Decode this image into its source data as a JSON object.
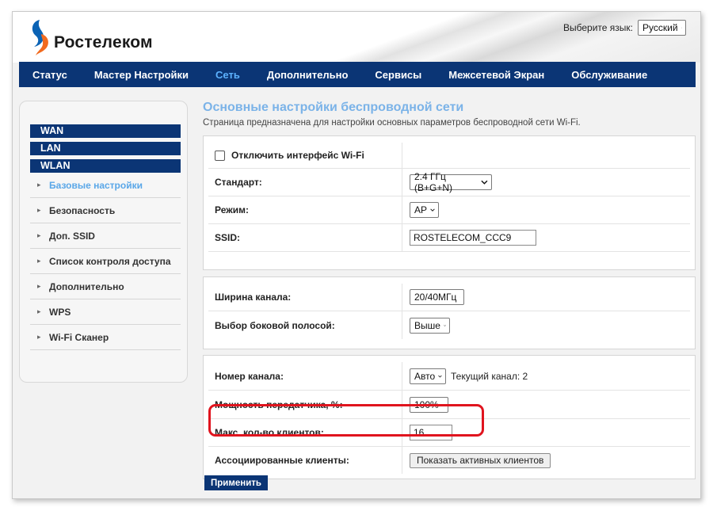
{
  "brand": {
    "name": "Ростелеком"
  },
  "language": {
    "label": "Выберите язык:",
    "selected": "Русский"
  },
  "nav": {
    "items": [
      {
        "label": "Статус"
      },
      {
        "label": "Мастер Настройки"
      },
      {
        "label": "Сеть"
      },
      {
        "label": "Дополнительно"
      },
      {
        "label": "Сервисы"
      },
      {
        "label": "Межсетевой Экран"
      },
      {
        "label": "Обслуживание"
      }
    ],
    "active": "Сеть"
  },
  "sidebar": {
    "sections": [
      "WAN",
      "LAN",
      "WLAN"
    ],
    "items": [
      {
        "label": "Базовые настройки"
      },
      {
        "label": "Безопасность"
      },
      {
        "label": "Доп. SSID"
      },
      {
        "label": "Список контроля доступа"
      },
      {
        "label": "Дополнительно"
      },
      {
        "label": "WPS"
      },
      {
        "label": "Wi-Fi Сканер"
      }
    ],
    "active": "Базовые настройки"
  },
  "main": {
    "title": "Основные настройки беспроводной сети",
    "description": "Страница предназначена для настройки основных параметров беспроводной сети Wi-Fi.",
    "panel1": {
      "disable_label": "Отключить интерфейс Wi-Fi",
      "disable_checked": false,
      "standard_label": "Стандарт:",
      "standard_value": "2.4 ГГц (B+G+N)",
      "mode_label": "Режим:",
      "mode_value": "AP",
      "ssid_label": "SSID:",
      "ssid_value": "ROSTELECOM_CCC9"
    },
    "panel2": {
      "width_label": "Ширина канала:",
      "width_value": "20/40МГц",
      "sideband_label": "Выбор боковой полосой:",
      "sideband_value": "Выше"
    },
    "panel3": {
      "channel_label": "Номер канала:",
      "channel_value": "Авто",
      "current_channel": "Текущий канал: 2",
      "power_label": "Мощность передатчика, %:",
      "power_value": "100%",
      "max_clients_label": "Макс. кол-во клиентов:",
      "max_clients_value": "16",
      "assoc_label": "Ассоциированные клиенты:",
      "assoc_button": "Показать активных клиентов"
    },
    "apply_button": "Применить"
  },
  "colors": {
    "nav_bg": "#0b3575",
    "accent": "#5aa7e8",
    "highlight": "#e0141e"
  }
}
